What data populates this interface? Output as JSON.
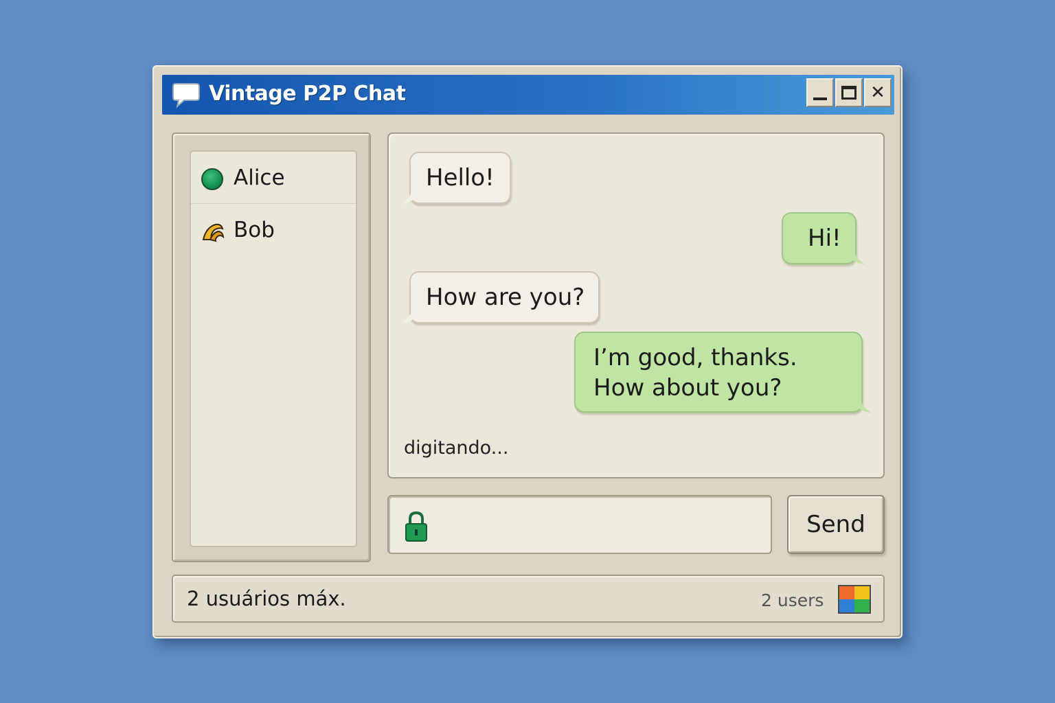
{
  "window": {
    "title": "Vintage P2P Chat",
    "controls": {
      "minimize": "minimize",
      "maximize": "maximize",
      "close": "✕"
    }
  },
  "sidebar": {
    "users": [
      {
        "name": "Alice",
        "status": "online",
        "status_icon": "green-circle",
        "status_color": "#1aa35a"
      },
      {
        "name": "Bob",
        "status": "away",
        "status_icon": "yellow-crescent",
        "status_color": "#e2a81f"
      }
    ]
  },
  "chat": {
    "messages": [
      {
        "direction": "incoming",
        "text": "Hello!"
      },
      {
        "direction": "outgoing",
        "text": "Hi!"
      },
      {
        "direction": "incoming",
        "text": "How are you?"
      },
      {
        "direction": "outgoing",
        "text": "I’m good, thanks. How about you?"
      }
    ],
    "typing_indicator": "digitando...",
    "incoming_color": "#f3efe6",
    "outgoing_color": "#bfe4a3"
  },
  "composer": {
    "lock_icon": "padlock-icon",
    "input_value": "",
    "input_placeholder": "",
    "send_label": "Send"
  },
  "statusbar": {
    "left_text": "2 usuários máx.",
    "right_text": "2 users",
    "icon": "network-grid-icon"
  },
  "colors": {
    "desktop": "#5f8ec4",
    "titlebar": "#1456b0",
    "window": "#dcd5c5"
  }
}
